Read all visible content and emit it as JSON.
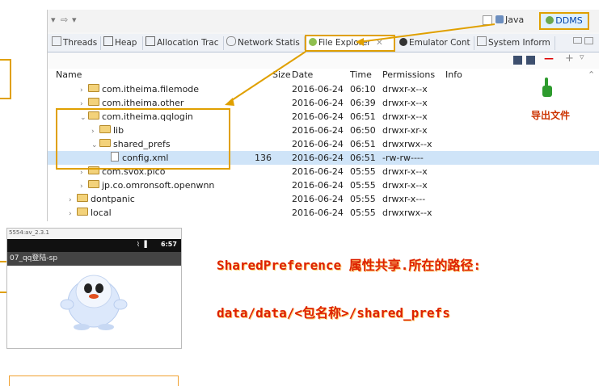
{
  "eclipse": {
    "nav": {
      "back": "▾",
      "fwd": "⇨",
      "more": "▾"
    },
    "perspectives": {
      "java": "Java",
      "ddms": "DDMS"
    },
    "tabs": [
      {
        "label": "Threads"
      },
      {
        "label": "Heap"
      },
      {
        "label": "Allocation Trac"
      },
      {
        "label": "Network Statis"
      },
      {
        "label": "File Explorer",
        "close": "✕"
      },
      {
        "label": "Emulator Cont"
      },
      {
        "label": "System Inform"
      }
    ],
    "table": {
      "headers": {
        "name": "Name",
        "size": "Size",
        "date": "Date",
        "time": "Time",
        "permissions": "Permissions",
        "info": "Info"
      },
      "rows": [
        {
          "chev": "›",
          "name": "com.itheima.filemode",
          "size": "",
          "date": "2016-06-24",
          "time": "06:10",
          "perm": "drwxr-x--x"
        },
        {
          "chev": "›",
          "name": "com.itheima.other",
          "size": "",
          "date": "2016-06-24",
          "time": "06:39",
          "perm": "drwxr-x--x"
        },
        {
          "chev": "⌄",
          "name": "com.itheima.qqlogin",
          "size": "",
          "date": "2016-06-24",
          "time": "06:51",
          "perm": "drwxr-x--x"
        },
        {
          "chev": "›",
          "name": "lib",
          "size": "",
          "date": "2016-06-24",
          "time": "06:50",
          "perm": "drwxr-xr-x"
        },
        {
          "chev": "⌄",
          "name": "shared_prefs",
          "size": "",
          "date": "2016-06-24",
          "time": "06:51",
          "perm": "drwxrwx--x"
        },
        {
          "chev": "",
          "name": "config.xml",
          "size": "136",
          "date": "2016-06-24",
          "time": "06:51",
          "perm": "-rw-rw----"
        },
        {
          "chev": "›",
          "name": "com.svox.pico",
          "size": "",
          "date": "2016-06-24",
          "time": "05:55",
          "perm": "drwxr-x--x"
        },
        {
          "chev": "›",
          "name": "jp.co.omronsoft.openwnn",
          "size": "",
          "date": "2016-06-24",
          "time": "05:55",
          "perm": "drwxr-x--x"
        },
        {
          "chev": "›",
          "name": "dontpanic",
          "size": "",
          "date": "2016-06-24",
          "time": "05:55",
          "perm": "drwxr-x---"
        },
        {
          "chev": "›",
          "name": "local",
          "size": "",
          "date": "2016-06-24",
          "time": "05:55",
          "perm": "drwxrwx--x"
        }
      ]
    },
    "export_label": "导出文件",
    "toolbar": {
      "minus": "—",
      "plus": "+",
      "menu": "▿"
    }
  },
  "phone": {
    "window_title": "5554:av_2.3.1",
    "clock": "6:57",
    "signal": "⌇ ▐",
    "app_title": "07_qq登陆-sp"
  },
  "captions": {
    "line1": "SharedPreference 属性共享.所在的路径:",
    "line2": "data/data/<包名称>/shared_prefs"
  },
  "colors": {
    "highlight_border": "#e0a000",
    "caption_red": "#dd2200",
    "selection": "#cfe4f8"
  }
}
